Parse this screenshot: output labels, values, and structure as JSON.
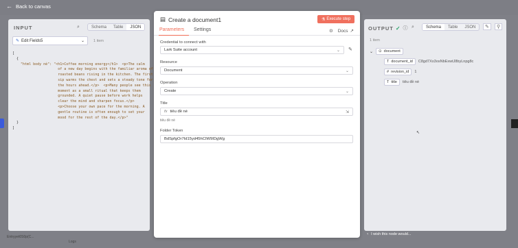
{
  "topbar": {
    "back_label": "Back to canvas",
    "back_icon": "arrow-left-icon"
  },
  "input": {
    "title": "INPUT",
    "view_tabs": [
      "Schema",
      "Table",
      "JSON"
    ],
    "active_view": "JSON",
    "node_select_value": "Edit Fields5",
    "item_count": "1 item",
    "json_lines": [
      "[",
      "  {",
      "    \"html body nè\": \"<h1>Coffee morning energy</h1>  <p>The calm",
      "                      of a new day begins with the familiar aroma of",
      "                      roasted beans rising in the kitchen. The first",
      "                      sip warms the chest and sets a steady tone for",
      "                      the hours ahead.</p>  <p>Many people see this",
      "                      moment as a small ritual that keeps them",
      "                      grounded. A quiet pause before work helps",
      "                      clear the mind and sharpen focus.</p>",
      "                      <p>Choose your own pace for the morning. A",
      "                      gentle routine is often enough to set your",
      "                      mood for the rest of the day.</p>\"",
      "  }",
      "]"
    ]
  },
  "modal": {
    "title": "Create a document1",
    "execute_label": "Execute step",
    "tabs": {
      "parameters": "Parameters",
      "settings": "Settings"
    },
    "docs_label": "Docs",
    "credential": {
      "label": "Credential to connect with",
      "value": "Lark Suite account"
    },
    "resource": {
      "label": "Resource",
      "value": "Document"
    },
    "operation": {
      "label": "Operation",
      "value": "Create"
    },
    "title_field": {
      "label": "Title",
      "value": "tiêu đề nè",
      "preview": "tiêu đề nè",
      "fx": "fx"
    },
    "folder_token": {
      "label": "Folder Token",
      "value": "BdSpfgOr7Id15yd45hCIW9IDgWg"
    }
  },
  "output": {
    "title": "OUTPUT",
    "view_tabs": [
      "Schema",
      "Table",
      "JSON"
    ],
    "active_view": "Schema",
    "item_count": "1 item",
    "root_key": "document",
    "fields": [
      {
        "key": "document_id",
        "value": "C8gd7Xo3osNbExwtJ8byLnpg8c"
      },
      {
        "key": "revision_id",
        "value": "1"
      },
      {
        "key": "title",
        "value": "tiêu đề nè"
      }
    ]
  },
  "footer": {
    "wish_label": "I wish this node would...",
    "bottom_left": "Entryyet0S0p(C...",
    "logs_label": "Logs"
  },
  "colors": {
    "accent": "#f0705e",
    "success": "#29a36a"
  }
}
